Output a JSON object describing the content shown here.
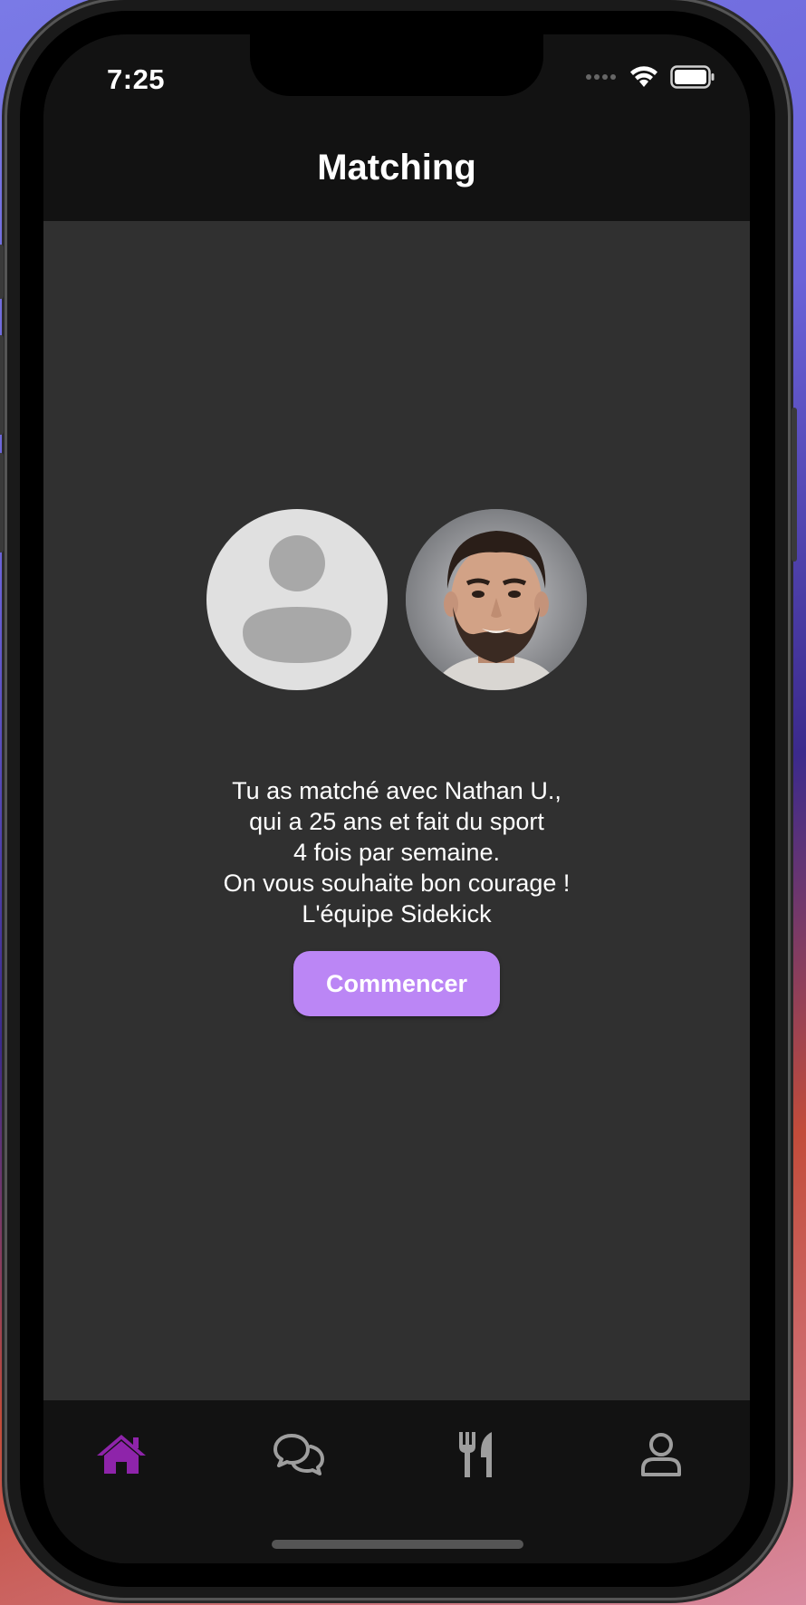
{
  "status_bar": {
    "time": "7:25",
    "icons": [
      "signal-dots-icon",
      "wifi-icon",
      "battery-icon"
    ]
  },
  "header": {
    "title": "Matching"
  },
  "match": {
    "avatars": [
      {
        "name": "default-avatar",
        "icon": "person-placeholder-icon"
      },
      {
        "name": "match-photo",
        "description_hidden": ""
      }
    ],
    "message_lines": [
      "Tu as matché avec Nathan U.,",
      "qui a 25 ans et fait du sport",
      "4 fois par semaine.",
      "On vous souhaite bon courage !",
      "L'équipe Sidekick"
    ],
    "button_label": "Commencer"
  },
  "tabbar": {
    "items": [
      {
        "icon": "home-icon",
        "active": true
      },
      {
        "icon": "chat-bubbles-icon",
        "active": false
      },
      {
        "icon": "fork-knife-icon",
        "active": false
      },
      {
        "icon": "profile-icon",
        "active": false
      }
    ]
  },
  "colors": {
    "accent": "#8e24aa",
    "button": "#bb86f5",
    "background": "#303030",
    "bar": "#121212",
    "inactive_icon": "#9e9e9e"
  }
}
